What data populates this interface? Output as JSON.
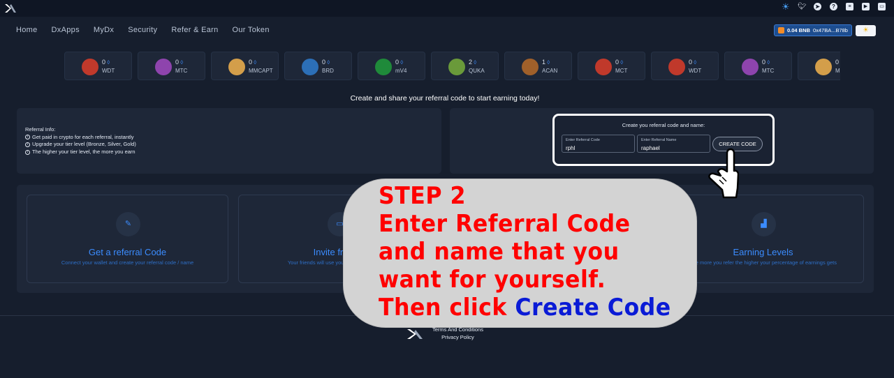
{
  "header": {
    "logo_icon": "dx-logo-icon",
    "icons": [
      "sun-icon",
      "twitter-icon",
      "telegram-icon",
      "help-icon",
      "document-icon",
      "youtube-icon",
      "monitor-icon"
    ]
  },
  "nav": {
    "items": [
      {
        "label": "Home"
      },
      {
        "label": "DxApps"
      },
      {
        "label": "MyDx"
      },
      {
        "label": "Security"
      },
      {
        "label": "Refer & Earn"
      },
      {
        "label": "Our Token"
      }
    ]
  },
  "wallet": {
    "balance": "0.04 BNB",
    "address": "0x47BA...B78b"
  },
  "tickers": [
    {
      "num": "0",
      "symbol": "WDT",
      "color": "#c0392b"
    },
    {
      "num": "0",
      "symbol": "MTC",
      "color": "#8e44ad"
    },
    {
      "num": "0",
      "symbol": "MMCAPT",
      "color": "#d39e4a"
    },
    {
      "num": "0",
      "symbol": "BRD",
      "color": "#2c6fb7"
    },
    {
      "num": "0",
      "symbol": "mV4",
      "color": "#1f8a3a"
    },
    {
      "num": "2",
      "symbol": "QUKA",
      "color": "#6a9a3a"
    },
    {
      "num": "1",
      "symbol": "ACAN",
      "color": "#a0602a"
    },
    {
      "num": "0",
      "symbol": "MCT",
      "color": "#c0392b"
    },
    {
      "num": "0",
      "symbol": "WDT",
      "color": "#c0392b"
    },
    {
      "num": "0",
      "symbol": "MTC",
      "color": "#8e44ad"
    },
    {
      "num": "0",
      "symbol": "MM",
      "color": "#d39e4a"
    }
  ],
  "tagline": "Create and share your referral code to start earning today!",
  "referral_info": {
    "title": "Referral Info:",
    "points": [
      "Get paid in crypto for each referral, instantly",
      "Upgrade your tier level (Bronze, Silver, Gold)",
      "The higher your tier level, the more you earn"
    ]
  },
  "create_form": {
    "title": "Create you referral code and name:",
    "code_label": "Enter Referral Code",
    "code_value": "rphl",
    "name_label": "Enter Referral Name",
    "name_value": "raphael",
    "button": "CREATE CODE"
  },
  "cards": [
    {
      "title": "Get a referral Code",
      "subtitle": "Connect your wallet and create your referral code / name",
      "icon": "user-edit-icon"
    },
    {
      "title": "Invite friends",
      "subtitle": "Your friends will use your referral code when",
      "icon": "inbox-icon"
    },
    {
      "title": "Earning Levels",
      "subtitle": "The more you refer the higher your percentage of earnings gets",
      "icon": "levels-icon"
    }
  ],
  "footer": {
    "terms": "Terms And Conditions",
    "privacy": "Privacy Policy"
  },
  "overlay": {
    "line1": "STEP 2",
    "line2": "Enter Referral Code",
    "line3": "and name that you",
    "line4": "want for yourself.",
    "line5_prefix": "Then click ",
    "line5_highlight": "Create Code",
    "text_color": "#ff0000",
    "highlight_color": "#0a1bd6"
  }
}
